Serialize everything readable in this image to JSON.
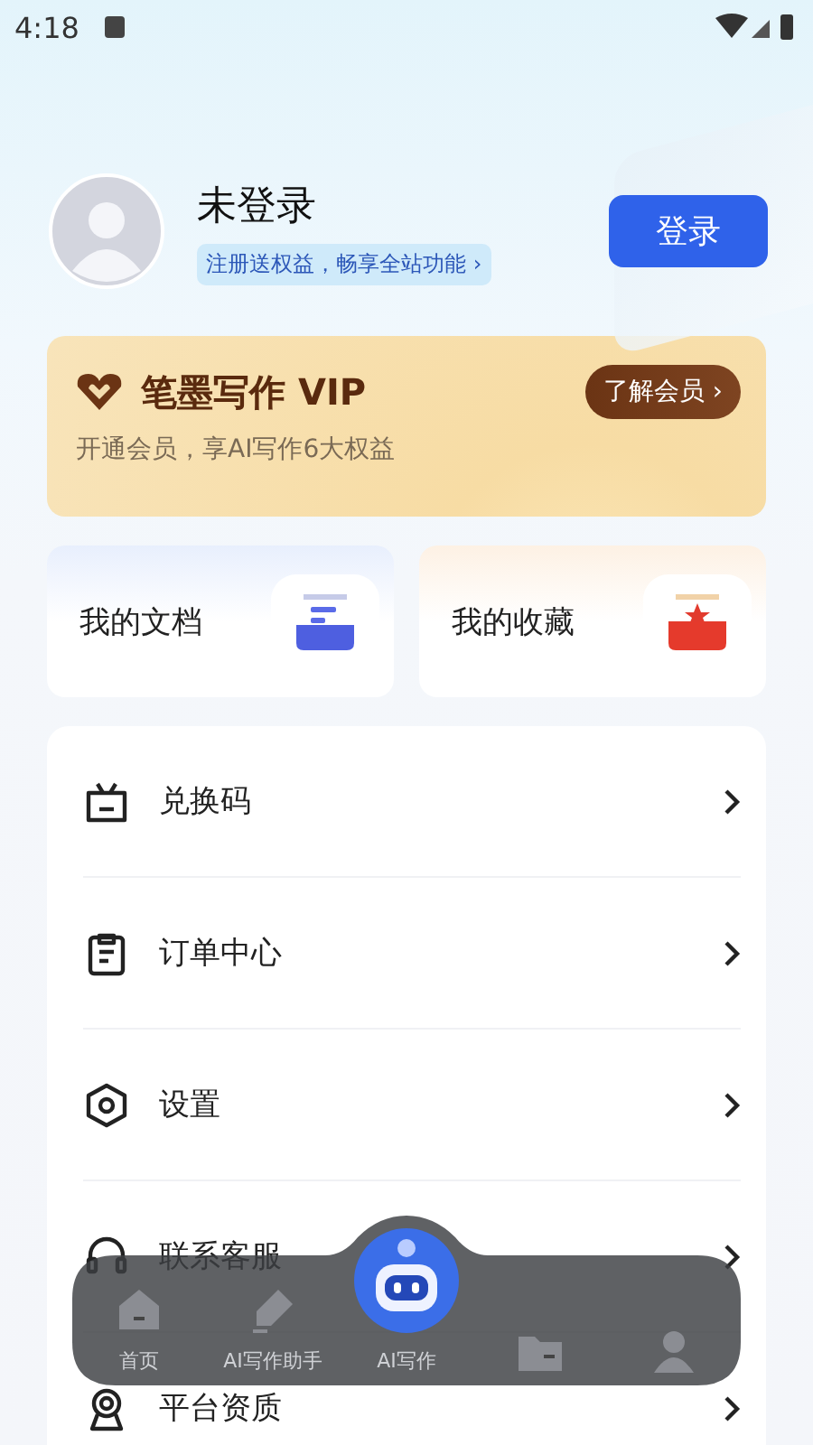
{
  "status_bar": {
    "time": "4:18"
  },
  "profile": {
    "name": "未登录",
    "promo": "注册送权益，畅享全站功能 ›",
    "login_button": "登录"
  },
  "vip": {
    "title": "笔墨写作 VIP",
    "subtitle": "开通会员，享AI写作6大权益",
    "button": "了解会员 ›"
  },
  "shortcuts": [
    {
      "label": "我的文档",
      "kind": "docs"
    },
    {
      "label": "我的收藏",
      "kind": "favorites"
    }
  ],
  "menu": [
    {
      "label": "兑换码",
      "kind": "gift"
    },
    {
      "label": "订单中心",
      "kind": "order"
    },
    {
      "label": "设置",
      "kind": "settings"
    },
    {
      "label": "联系客服",
      "kind": "support"
    },
    {
      "label": "平台资质",
      "kind": "badge"
    }
  ],
  "bottom_nav": [
    {
      "label": "首页",
      "kind": "home"
    },
    {
      "label": "AI写作助手",
      "kind": "pen"
    },
    {
      "label": "AI写作",
      "kind": "robot"
    },
    {
      "kind": "folder"
    },
    {
      "kind": "user"
    }
  ]
}
